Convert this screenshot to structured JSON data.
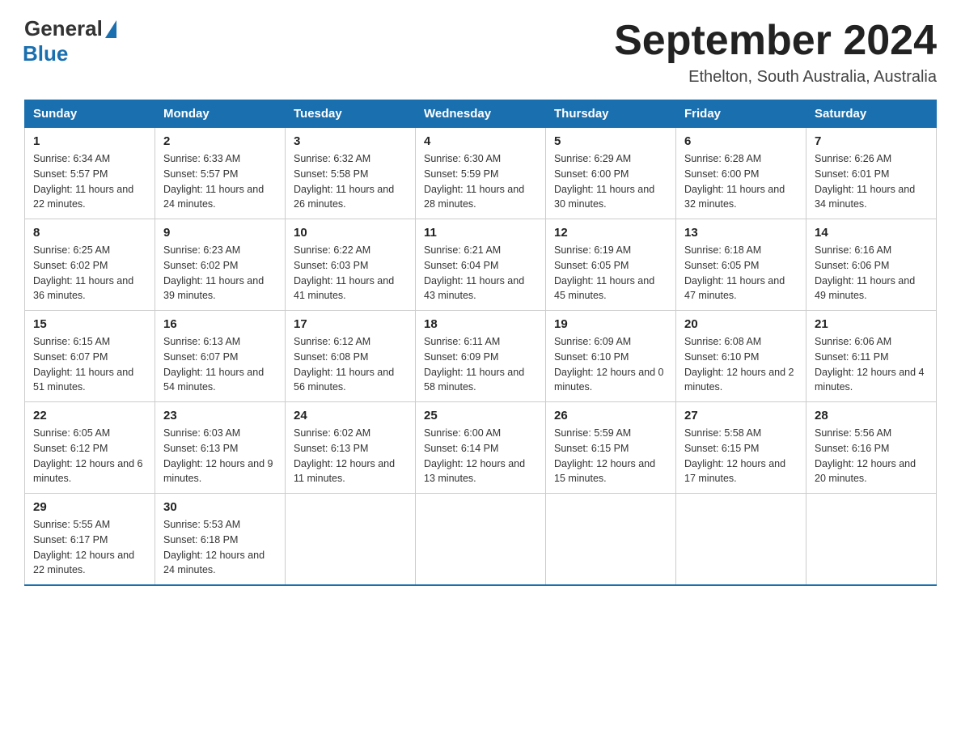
{
  "header": {
    "logo_general": "General",
    "logo_blue": "Blue",
    "month_title": "September 2024",
    "location": "Ethelton, South Australia, Australia"
  },
  "days_of_week": [
    "Sunday",
    "Monday",
    "Tuesday",
    "Wednesday",
    "Thursday",
    "Friday",
    "Saturday"
  ],
  "weeks": [
    [
      {
        "day": "1",
        "sunrise": "Sunrise: 6:34 AM",
        "sunset": "Sunset: 5:57 PM",
        "daylight": "Daylight: 11 hours and 22 minutes."
      },
      {
        "day": "2",
        "sunrise": "Sunrise: 6:33 AM",
        "sunset": "Sunset: 5:57 PM",
        "daylight": "Daylight: 11 hours and 24 minutes."
      },
      {
        "day": "3",
        "sunrise": "Sunrise: 6:32 AM",
        "sunset": "Sunset: 5:58 PM",
        "daylight": "Daylight: 11 hours and 26 minutes."
      },
      {
        "day": "4",
        "sunrise": "Sunrise: 6:30 AM",
        "sunset": "Sunset: 5:59 PM",
        "daylight": "Daylight: 11 hours and 28 minutes."
      },
      {
        "day": "5",
        "sunrise": "Sunrise: 6:29 AM",
        "sunset": "Sunset: 6:00 PM",
        "daylight": "Daylight: 11 hours and 30 minutes."
      },
      {
        "day": "6",
        "sunrise": "Sunrise: 6:28 AM",
        "sunset": "Sunset: 6:00 PM",
        "daylight": "Daylight: 11 hours and 32 minutes."
      },
      {
        "day": "7",
        "sunrise": "Sunrise: 6:26 AM",
        "sunset": "Sunset: 6:01 PM",
        "daylight": "Daylight: 11 hours and 34 minutes."
      }
    ],
    [
      {
        "day": "8",
        "sunrise": "Sunrise: 6:25 AM",
        "sunset": "Sunset: 6:02 PM",
        "daylight": "Daylight: 11 hours and 36 minutes."
      },
      {
        "day": "9",
        "sunrise": "Sunrise: 6:23 AM",
        "sunset": "Sunset: 6:02 PM",
        "daylight": "Daylight: 11 hours and 39 minutes."
      },
      {
        "day": "10",
        "sunrise": "Sunrise: 6:22 AM",
        "sunset": "Sunset: 6:03 PM",
        "daylight": "Daylight: 11 hours and 41 minutes."
      },
      {
        "day": "11",
        "sunrise": "Sunrise: 6:21 AM",
        "sunset": "Sunset: 6:04 PM",
        "daylight": "Daylight: 11 hours and 43 minutes."
      },
      {
        "day": "12",
        "sunrise": "Sunrise: 6:19 AM",
        "sunset": "Sunset: 6:05 PM",
        "daylight": "Daylight: 11 hours and 45 minutes."
      },
      {
        "day": "13",
        "sunrise": "Sunrise: 6:18 AM",
        "sunset": "Sunset: 6:05 PM",
        "daylight": "Daylight: 11 hours and 47 minutes."
      },
      {
        "day": "14",
        "sunrise": "Sunrise: 6:16 AM",
        "sunset": "Sunset: 6:06 PM",
        "daylight": "Daylight: 11 hours and 49 minutes."
      }
    ],
    [
      {
        "day": "15",
        "sunrise": "Sunrise: 6:15 AM",
        "sunset": "Sunset: 6:07 PM",
        "daylight": "Daylight: 11 hours and 51 minutes."
      },
      {
        "day": "16",
        "sunrise": "Sunrise: 6:13 AM",
        "sunset": "Sunset: 6:07 PM",
        "daylight": "Daylight: 11 hours and 54 minutes."
      },
      {
        "day": "17",
        "sunrise": "Sunrise: 6:12 AM",
        "sunset": "Sunset: 6:08 PM",
        "daylight": "Daylight: 11 hours and 56 minutes."
      },
      {
        "day": "18",
        "sunrise": "Sunrise: 6:11 AM",
        "sunset": "Sunset: 6:09 PM",
        "daylight": "Daylight: 11 hours and 58 minutes."
      },
      {
        "day": "19",
        "sunrise": "Sunrise: 6:09 AM",
        "sunset": "Sunset: 6:10 PM",
        "daylight": "Daylight: 12 hours and 0 minutes."
      },
      {
        "day": "20",
        "sunrise": "Sunrise: 6:08 AM",
        "sunset": "Sunset: 6:10 PM",
        "daylight": "Daylight: 12 hours and 2 minutes."
      },
      {
        "day": "21",
        "sunrise": "Sunrise: 6:06 AM",
        "sunset": "Sunset: 6:11 PM",
        "daylight": "Daylight: 12 hours and 4 minutes."
      }
    ],
    [
      {
        "day": "22",
        "sunrise": "Sunrise: 6:05 AM",
        "sunset": "Sunset: 6:12 PM",
        "daylight": "Daylight: 12 hours and 6 minutes."
      },
      {
        "day": "23",
        "sunrise": "Sunrise: 6:03 AM",
        "sunset": "Sunset: 6:13 PM",
        "daylight": "Daylight: 12 hours and 9 minutes."
      },
      {
        "day": "24",
        "sunrise": "Sunrise: 6:02 AM",
        "sunset": "Sunset: 6:13 PM",
        "daylight": "Daylight: 12 hours and 11 minutes."
      },
      {
        "day": "25",
        "sunrise": "Sunrise: 6:00 AM",
        "sunset": "Sunset: 6:14 PM",
        "daylight": "Daylight: 12 hours and 13 minutes."
      },
      {
        "day": "26",
        "sunrise": "Sunrise: 5:59 AM",
        "sunset": "Sunset: 6:15 PM",
        "daylight": "Daylight: 12 hours and 15 minutes."
      },
      {
        "day": "27",
        "sunrise": "Sunrise: 5:58 AM",
        "sunset": "Sunset: 6:15 PM",
        "daylight": "Daylight: 12 hours and 17 minutes."
      },
      {
        "day": "28",
        "sunrise": "Sunrise: 5:56 AM",
        "sunset": "Sunset: 6:16 PM",
        "daylight": "Daylight: 12 hours and 20 minutes."
      }
    ],
    [
      {
        "day": "29",
        "sunrise": "Sunrise: 5:55 AM",
        "sunset": "Sunset: 6:17 PM",
        "daylight": "Daylight: 12 hours and 22 minutes."
      },
      {
        "day": "30",
        "sunrise": "Sunrise: 5:53 AM",
        "sunset": "Sunset: 6:18 PM",
        "daylight": "Daylight: 12 hours and 24 minutes."
      },
      null,
      null,
      null,
      null,
      null
    ]
  ]
}
